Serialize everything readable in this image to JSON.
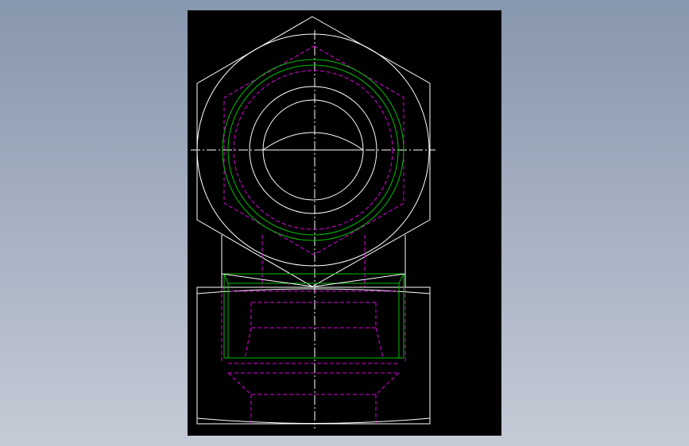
{
  "viewer": {
    "background": "#000000",
    "canvas_background": "#8797ad"
  },
  "drawing": {
    "colors": {
      "outline": "#ffffff",
      "thread": "#00c000",
      "hidden": "#e000e0"
    }
  }
}
